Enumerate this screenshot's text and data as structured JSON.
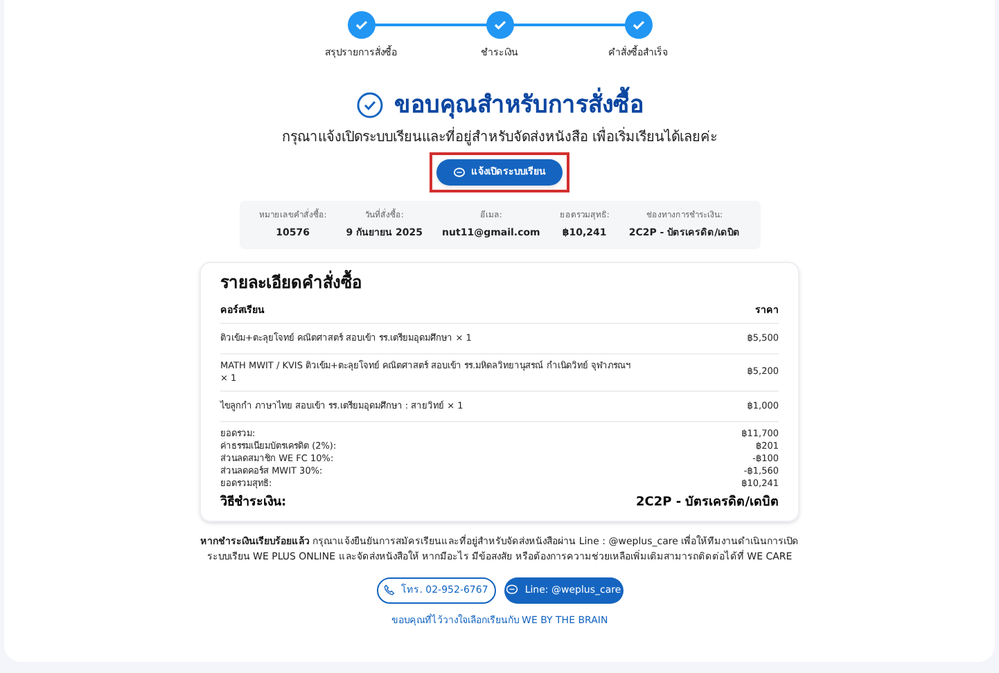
{
  "steps": [
    {
      "label": "สรุปรายการสั่งซื้อ",
      "done": true
    },
    {
      "label": "ชำระเงิน",
      "done": true
    },
    {
      "label": "คำสั่งซื้อสำเร็จ",
      "done": true
    }
  ],
  "title": "ขอบคุณสำหรับการสั่งซื้อ",
  "subtitle": "กรุณาแจ้งเปิดระบบเรียนและที่อยู่สำหรับจัดส่งหนังสือ เพื่อเริ่มเรียนได้เลยค่ะ",
  "primary_button": {
    "label": "แจ้งเปิดระบบเรียน",
    "highlighted": true
  },
  "summary": [
    {
      "label": "หมายเลขคำสั่งซื้อ:",
      "value": "10576"
    },
    {
      "label": "วันที่สั่งซื้อ:",
      "value": "9 กันยายน 2025"
    },
    {
      "label": "อีเมล:",
      "value": "nut11@gmail.com"
    },
    {
      "label": "ยอดรวมสุทธิ:",
      "value": "฿10,241"
    },
    {
      "label": "ช่องทางการชำระเงิน:",
      "value": "2C2P - บัตรเครดิต/เดบิต"
    }
  ],
  "order": {
    "title": "รายละเอียดคำสั่งซื้อ",
    "columns": [
      "คอร์สเรียน",
      "ราคา"
    ],
    "rows": [
      {
        "course": "ติวเข้ม+ตะลุยโจทย์ คณิตศาสตร์ สอบเข้า รร.เตรียมอุดมศึกษา × 1",
        "price": "฿5,500"
      },
      {
        "course": "MATH MWIT / KVIS ติวเข้ม+ตะลุยโจทย์ คณิตศาสตร์ สอบเข้า รร.มหิดลวิทยานุสรณ์ กำเนิดวิทย์ จุฬาภรณฯ × 1",
        "price": "฿5,200"
      },
      {
        "course": "ไขลูกกำ ภาษาไทย สอบเข้า รร.เตรียมอุดมศึกษา : สายวิทย์ × 1",
        "price": "฿1,000"
      }
    ],
    "totals": [
      {
        "label": "ยอดรวม:",
        "value": "฿11,700"
      },
      {
        "label": "ค่าธรรมเนียมบัตรเครดิต (2%):",
        "value": "฿201"
      },
      {
        "label": "ส่วนลดสมาชิก WE FC 10%:",
        "value": "-฿100"
      },
      {
        "label": "ส่วนลดคอร์ส MWIT 30%:",
        "value": "-฿1,560"
      },
      {
        "label": "ยอดรวมสุทธิ:",
        "value": "฿10,241"
      }
    ],
    "payment": {
      "label": "วิธีชำระเงิน:",
      "value": "2C2P - บัตรเครดิต/เดบิต"
    }
  },
  "notice": "**หากชำระเงินเรียบร้อยแล้ว** กรุณาแจ้งยืนยันการสมัครเรียนและที่อยู่สำหรับจัดส่งหนังสือผ่าน Line : @weplus_care เพื่อให้ทีมงานดำเนินการเปิดระบบเรียน WE PLUS ONLINE และจัดส่งหนังสือให้ หากมีอะไร มีข้อสงสัย หรือต้องการความช่วยเหลือเพิ่มเติมสามารถติดต่อได้ที่ WE CARE",
  "contact_buttons": [
    {
      "kind": "phone",
      "label": "โทร. 02-952-6767"
    },
    {
      "kind": "line",
      "label": "Line: @weplus_care"
    }
  ],
  "footer_link": "ขอบคุณที่ไว้วางใจเลือกเรียนกับ WE BY THE BRAIN"
}
